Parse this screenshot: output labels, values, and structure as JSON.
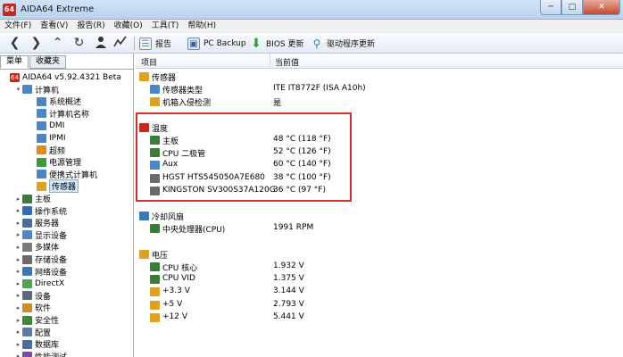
{
  "window": {
    "title": "AIDA64 Extreme",
    "app_icon_text": "64",
    "min": "─",
    "max": "□",
    "close": "✕"
  },
  "menu": [
    "文件(F)",
    "查看(V)",
    "报告(R)",
    "收藏(O)",
    "工具(T)",
    "帮助(H)"
  ],
  "toolbar": {
    "report": "报告",
    "pc_backup": "PC Backup",
    "bios_update": "BIOS 更新",
    "driver_update": "驱动程序更新"
  },
  "left": {
    "tabs": [
      "菜单",
      "收藏夹"
    ],
    "tree": [
      {
        "label": "AIDA64 v5.92.4321 Beta",
        "level": 0,
        "exp": "",
        "icon": "64",
        "color": "#c8281e"
      },
      {
        "label": "计算机",
        "level": 1,
        "exp": "▾",
        "icon": "",
        "color": "#4a86c8"
      },
      {
        "label": "系统概述",
        "level": 2,
        "exp": "",
        "icon": "",
        "color": "#4a86c8"
      },
      {
        "label": "计算机名称",
        "level": 2,
        "exp": "",
        "icon": "",
        "color": "#4a86c8"
      },
      {
        "label": "DMI",
        "level": 2,
        "exp": "",
        "icon": "",
        "color": "#4a86c8"
      },
      {
        "label": "IPMI",
        "level": 2,
        "exp": "",
        "icon": "",
        "color": "#4a86c8"
      },
      {
        "label": "超频",
        "level": 2,
        "exp": "",
        "icon": "",
        "color": "#e38a1c"
      },
      {
        "label": "电源管理",
        "level": 2,
        "exp": "",
        "icon": "",
        "color": "#3b9a3b"
      },
      {
        "label": "便携式计算机",
        "level": 2,
        "exp": "",
        "icon": "",
        "color": "#4a86c8"
      },
      {
        "label": "传感器",
        "level": 2,
        "exp": "",
        "icon": "",
        "color": "#e0a020",
        "selected": true
      },
      {
        "label": "主板",
        "level": 1,
        "exp": "▸",
        "icon": "",
        "color": "#3b7a3b"
      },
      {
        "label": "操作系统",
        "level": 1,
        "exp": "▸",
        "icon": "",
        "color": "#2d6cc0"
      },
      {
        "label": "服务器",
        "level": 1,
        "exp": "▸",
        "icon": "",
        "color": "#4a6e9a"
      },
      {
        "label": "显示设备",
        "level": 1,
        "exp": "▸",
        "icon": "",
        "color": "#4a86c8"
      },
      {
        "label": "多媒体",
        "level": 1,
        "exp": "▸",
        "icon": "",
        "color": "#7a7a7a"
      },
      {
        "label": "存储设备",
        "level": 1,
        "exp": "▸",
        "icon": "",
        "color": "#6a6a6a"
      },
      {
        "label": "网络设备",
        "level": 1,
        "exp": "▸",
        "icon": "",
        "color": "#3a78b8"
      },
      {
        "label": "DirectX",
        "level": 1,
        "exp": "▸",
        "icon": "",
        "color": "#4aa84a"
      },
      {
        "label": "设备",
        "level": 1,
        "exp": "▸",
        "icon": "",
        "color": "#5a6a7a"
      },
      {
        "label": "软件",
        "level": 1,
        "exp": "▸",
        "icon": "",
        "color": "#d08a2a"
      },
      {
        "label": "安全性",
        "level": 1,
        "exp": "▸",
        "icon": "",
        "color": "#3a8a3a"
      },
      {
        "label": "配置",
        "level": 1,
        "exp": "▸",
        "icon": "",
        "color": "#5a7aa8"
      },
      {
        "label": "数据库",
        "level": 1,
        "exp": "▸",
        "icon": "",
        "color": "#4a6aa8"
      },
      {
        "label": "性能测试",
        "level": 1,
        "exp": "▸",
        "icon": "",
        "color": "#7a4aa8"
      }
    ]
  },
  "columns": {
    "item": "项目",
    "value": "当前值"
  },
  "rows": [
    {
      "label": "传感器",
      "value": "",
      "indent": 0,
      "color": "#e0a020"
    },
    {
      "label": "传感器类型",
      "value": "ITE IT8772F  (ISA A10h)",
      "indent": 1,
      "color": "#4a86c8"
    },
    {
      "label": "机箱入侵检测",
      "value": "是",
      "indent": 1,
      "color": "#e0a020"
    },
    {
      "label": "",
      "value": "",
      "indent": 0,
      "color": ""
    },
    {
      "label": "温度",
      "value": "",
      "indent": 0,
      "color": "#c8281e"
    },
    {
      "label": "主板",
      "value": "48 °C  (118 °F)",
      "indent": 1,
      "color": "#3b7a3b"
    },
    {
      "label": "CPU 二极管",
      "value": "52 °C  (126 °F)",
      "indent": 1,
      "color": "#3b7a3b"
    },
    {
      "label": "Aux",
      "value": "60 °C  (140 °F)",
      "indent": 1,
      "color": "#4a86c8"
    },
    {
      "label": "HGST HTS545050A7E680",
      "value": "38 °C  (100 °F)",
      "indent": 1,
      "color": "#6a6a6a"
    },
    {
      "label": "KINGSTON SV300S37A120G",
      "value": "36 °C  (97 °F)",
      "indent": 1,
      "color": "#6a6a6a"
    },
    {
      "label": "",
      "value": "",
      "indent": 0,
      "color": ""
    },
    {
      "label": "冷却风扇",
      "value": "",
      "indent": 0,
      "color": "#3a78b8"
    },
    {
      "label": "中央处理器(CPU)",
      "value": "1991 RPM",
      "indent": 1,
      "color": "#3b7a3b"
    },
    {
      "label": "",
      "value": "",
      "indent": 0,
      "color": ""
    },
    {
      "label": "电压",
      "value": "",
      "indent": 0,
      "color": "#e0a020"
    },
    {
      "label": "CPU 核心",
      "value": "1.932 V",
      "indent": 1,
      "color": "#3b7a3b"
    },
    {
      "label": "CPU VID",
      "value": "1.375 V",
      "indent": 1,
      "color": "#3b7a3b"
    },
    {
      "label": "+3.3 V",
      "value": "3.144 V",
      "indent": 1,
      "color": "#e0a020"
    },
    {
      "label": "+5 V",
      "value": "2.793 V",
      "indent": 1,
      "color": "#e0a020"
    },
    {
      "label": "+12 V",
      "value": "5.441 V",
      "indent": 1,
      "color": "#e0a020"
    }
  ]
}
